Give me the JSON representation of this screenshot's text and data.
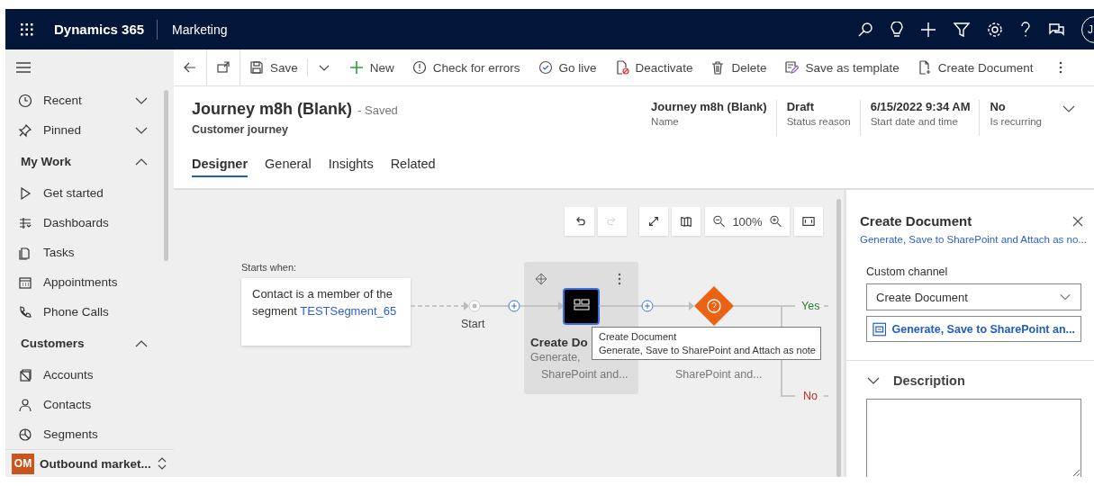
{
  "topbar": {
    "app_name": "Dynamics 365",
    "area": "Marketing",
    "avatar": "J"
  },
  "sidebar": {
    "top": [
      {
        "label": "Recent",
        "expanded": false
      },
      {
        "label": "Pinned",
        "expanded": false
      }
    ],
    "groups": [
      {
        "title": "My Work",
        "expanded": true,
        "items": [
          "Get started",
          "Dashboards",
          "Tasks",
          "Appointments",
          "Phone Calls"
        ]
      },
      {
        "title": "Customers",
        "expanded": true,
        "items": [
          "Accounts",
          "Contacts",
          "Segments"
        ]
      }
    ],
    "area": {
      "badge": "OM",
      "label": "Outbound market..."
    }
  },
  "commands": [
    {
      "kind": "back"
    },
    {
      "kind": "popout"
    },
    {
      "kind": "save",
      "label": "Save"
    },
    {
      "kind": "split"
    },
    {
      "kind": "new",
      "label": "New"
    },
    {
      "kind": "check",
      "label": "Check for errors"
    },
    {
      "kind": "golive",
      "label": "Go live"
    },
    {
      "kind": "deactivate",
      "label": "Deactivate"
    },
    {
      "kind": "delete",
      "label": "Delete"
    },
    {
      "kind": "template",
      "label": "Save as template"
    },
    {
      "kind": "document",
      "label": "Create Document"
    },
    {
      "kind": "more"
    }
  ],
  "header": {
    "title": "Journey m8h (Blank)",
    "status": "- Saved",
    "subtitle": "Customer journey",
    "fields": [
      {
        "value": "Journey m8h (Blank)",
        "label": "Name"
      },
      {
        "value": "Draft",
        "label": "Status reason"
      },
      {
        "value": "6/15/2022 9:34 AM",
        "label": "Start date and time"
      },
      {
        "value": "No",
        "label": "Is recurring"
      }
    ]
  },
  "tabs": [
    {
      "label": "Designer",
      "selected": true
    },
    {
      "label": "General",
      "selected": false
    },
    {
      "label": "Insights",
      "selected": false
    },
    {
      "label": "Related",
      "selected": false
    }
  ],
  "canvas": {
    "tools": [
      {
        "kind": "undo",
        "disabled": false
      },
      {
        "kind": "redo",
        "disabled": true
      },
      {
        "kind": "expand",
        "disabled": false
      },
      {
        "kind": "map",
        "disabled": false
      },
      {
        "kind": "zoom",
        "label": "100%"
      },
      {
        "kind": "fit",
        "disabled": false
      }
    ],
    "trigger": {
      "caption": "Starts when:",
      "text": "Contact is a member of the segment",
      "link": "TESTSegment_65"
    },
    "start_label": "Start",
    "tile": {
      "title": "Create Do",
      "lines": [
        "Generate,",
        "SharePoint and..."
      ]
    },
    "condition": {
      "lines": [
        "SharePoint and..."
      ],
      "yes": "Yes",
      "no": "No"
    },
    "tooltip": {
      "title": "Create Document",
      "text": "Generate, Save to SharePoint and Attach as note"
    }
  },
  "panel": {
    "title": "Create Document",
    "subtitle": "Generate, Save to SharePoint and Attach as no...",
    "field_label": "Custom channel",
    "dropdown": "Create Document",
    "link_button": "Generate, Save to SharePoint an...",
    "section": {
      "title": "Description",
      "expanded": true
    }
  }
}
